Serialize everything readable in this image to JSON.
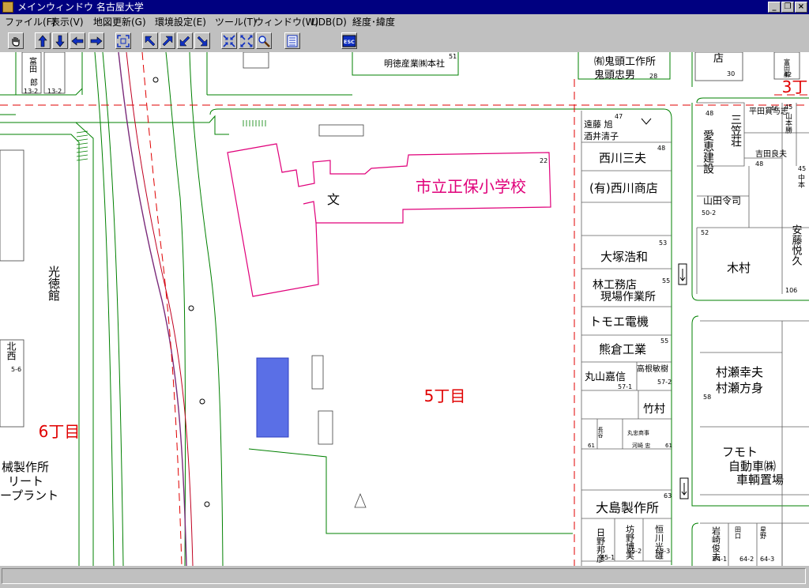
{
  "window": {
    "title": "メインウィンドウ 名古屋大学",
    "app_icon": "map-app-icon",
    "controls": [
      "minimize-icon",
      "restore-icon",
      "close-icon"
    ]
  },
  "menu": [
    {
      "id": "file",
      "label": "ファイル(F)"
    },
    {
      "id": "view",
      "label": "表示(V)"
    },
    {
      "id": "mapupdate",
      "label": "地図更新(G)"
    },
    {
      "id": "envsettings",
      "label": "環境設定(E)"
    },
    {
      "id": "tools",
      "label": "ツール(T)"
    },
    {
      "id": "window",
      "label": "ウィンドウ(W)"
    },
    {
      "id": "udb",
      "label": "UDB(D)"
    },
    {
      "id": "latlon",
      "label": "経度･緯度"
    }
  ],
  "toolbar": {
    "esc_label": "ESC",
    "buttons": [
      "hand-icon",
      "arrow-up-icon",
      "arrow-down-icon",
      "arrow-left-icon",
      "arrow-right-icon",
      "fit-view-icon",
      "arrow-nw-icon",
      "arrow-ne-icon",
      "arrow-sw-icon",
      "arrow-se-icon",
      "zoom-out-icon",
      "zoom-in-icon",
      "zoom-magnifier-icon",
      "list-icon",
      "esc-icon"
    ]
  },
  "colors": {
    "titlebar": "#000080",
    "window_bg": "#c0c0c0",
    "road": "#008000",
    "boundary": "#e00000",
    "school": "#e0007a",
    "highlight": "#5a6fe6"
  },
  "map": {
    "districts": [
      {
        "id": "5chome",
        "label": "5丁目"
      },
      {
        "id": "6chome",
        "label": "6丁目"
      },
      {
        "id": "3chome",
        "label": "3丁"
      }
    ],
    "school": {
      "label": "市立正保小学校",
      "symbol": "文",
      "number": "22"
    },
    "buildings": {
      "meitoku": {
        "label": "明徳産業㈱本社",
        "number": "51"
      },
      "onigashira": {
        "line1": "㈲鬼頭工作所",
        "line2": "鬼頭忠男",
        "number": "28"
      },
      "top_mid": {
        "label": "店",
        "number": "30"
      },
      "top_right_vertical": {
        "label": "富田勝",
        "number": "42"
      },
      "top_left_a": {
        "label": "富田",
        "number": "13-2"
      },
      "top_left_b": {
        "label": "郎",
        "number": "13-2"
      },
      "endo": {
        "line1": "遠藤 旭",
        "line2": "酒井清子",
        "number": "47"
      },
      "nishikawa1": {
        "label": "西川三夫",
        "number": "48"
      },
      "nishikawa2": {
        "label": "(有)西川商店"
      },
      "otsuka": {
        "label": "大塚浩和",
        "number": "53"
      },
      "hayashi": {
        "line1": "林工務店",
        "line2": "現場作業所",
        "number": "55"
      },
      "tomoe": {
        "label": "トモエ電機"
      },
      "kumakura": {
        "label": "熊倉工業",
        "number": "55"
      },
      "maruyama": {
        "label": "丸山嘉信",
        "number": "57-1"
      },
      "takanekatsu": {
        "label": "高根敏樹",
        "number": "57-2"
      },
      "takemura": {
        "label": "竹村"
      },
      "small_a": {
        "label": "長谷",
        "number": "61"
      },
      "small_b": {
        "label": "丸忠商事",
        "number": "61"
      },
      "small_c": {
        "label": "河崎 忠",
        "number": "61"
      },
      "oshima": {
        "label": "大島製作所",
        "number": "63"
      },
      "hino": {
        "label": "日野邦彦",
        "number": "65-1"
      },
      "bono": {
        "label": "坊野博実",
        "number": "65-2"
      },
      "tsunekawa": {
        "label": "恒川光雄",
        "number": "65-3"
      },
      "aike": {
        "label": "愛恵建設",
        "number": "48"
      },
      "mikasaso": {
        "label": "三笠荘",
        "number": ""
      },
      "hirata": {
        "label": "平田貫与志",
        "number": "46"
      },
      "yamamoto_katsu": {
        "label": "山本勝",
        "number": "45"
      },
      "yoshida": {
        "label": "吉田良夫",
        "number": "48"
      },
      "nakamoto": {
        "label": "中本",
        "number": "45"
      },
      "yamada": {
        "label": "山田令司",
        "number": "50-2"
      },
      "ando": {
        "label": "安藤悦久",
        "number": "106"
      },
      "kimura": {
        "label": "木村",
        "number": "52"
      },
      "murase": {
        "line1": "村瀬幸夫",
        "line2": "村瀬方身",
        "number": "58"
      },
      "fumoto": {
        "line1": "フモト",
        "line2": "自動車㈱",
        "line3": "車輌置場"
      },
      "iwasaki": {
        "label": "岩崎俊夫",
        "number": "64-1"
      },
      "taguchi": {
        "label": "田口",
        "number": "64-2"
      },
      "hoshino": {
        "label": "星野",
        "number": "64-3"
      },
      "kotokukan": {
        "label": "光徳館"
      },
      "kita": {
        "label": "北西",
        "number": "5-6"
      },
      "kikai": {
        "label": "械製作所"
      },
      "rito": {
        "label": "リート"
      },
      "plant": {
        "label": "ープラント"
      }
    }
  }
}
